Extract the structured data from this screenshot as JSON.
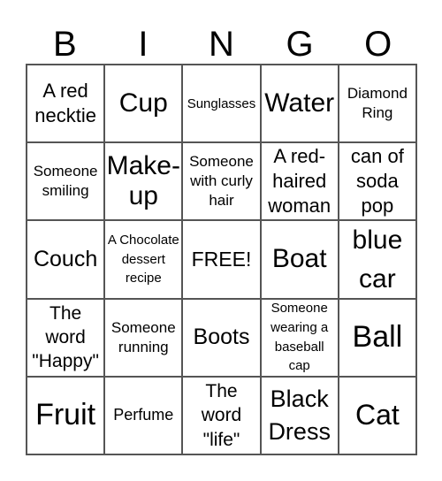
{
  "header": {
    "letters": [
      "B",
      "I",
      "N",
      "G",
      "O"
    ]
  },
  "cells": [
    [
      "A red necktie",
      "Cup",
      "Sunglasses",
      "Water",
      "Diamond Ring"
    ],
    [
      "Someone smiling",
      "Make-up",
      "Someone with curly hair",
      "A red-haired woman",
      "can of soda pop"
    ],
    [
      "Couch",
      "A Chocolate dessert recipe",
      "FREE!",
      "Boat",
      "blue car"
    ],
    [
      "The word \"Happy\"",
      "Someone running",
      "Boots",
      "Someone wearing a baseball cap",
      "Ball"
    ],
    [
      "Fruit",
      "Perfume",
      "The word \"life\"",
      "Black Dress",
      "Cat"
    ]
  ],
  "colors": {
    "text": "#000000",
    "grid_line": "#555555",
    "background": "#ffffff"
  }
}
